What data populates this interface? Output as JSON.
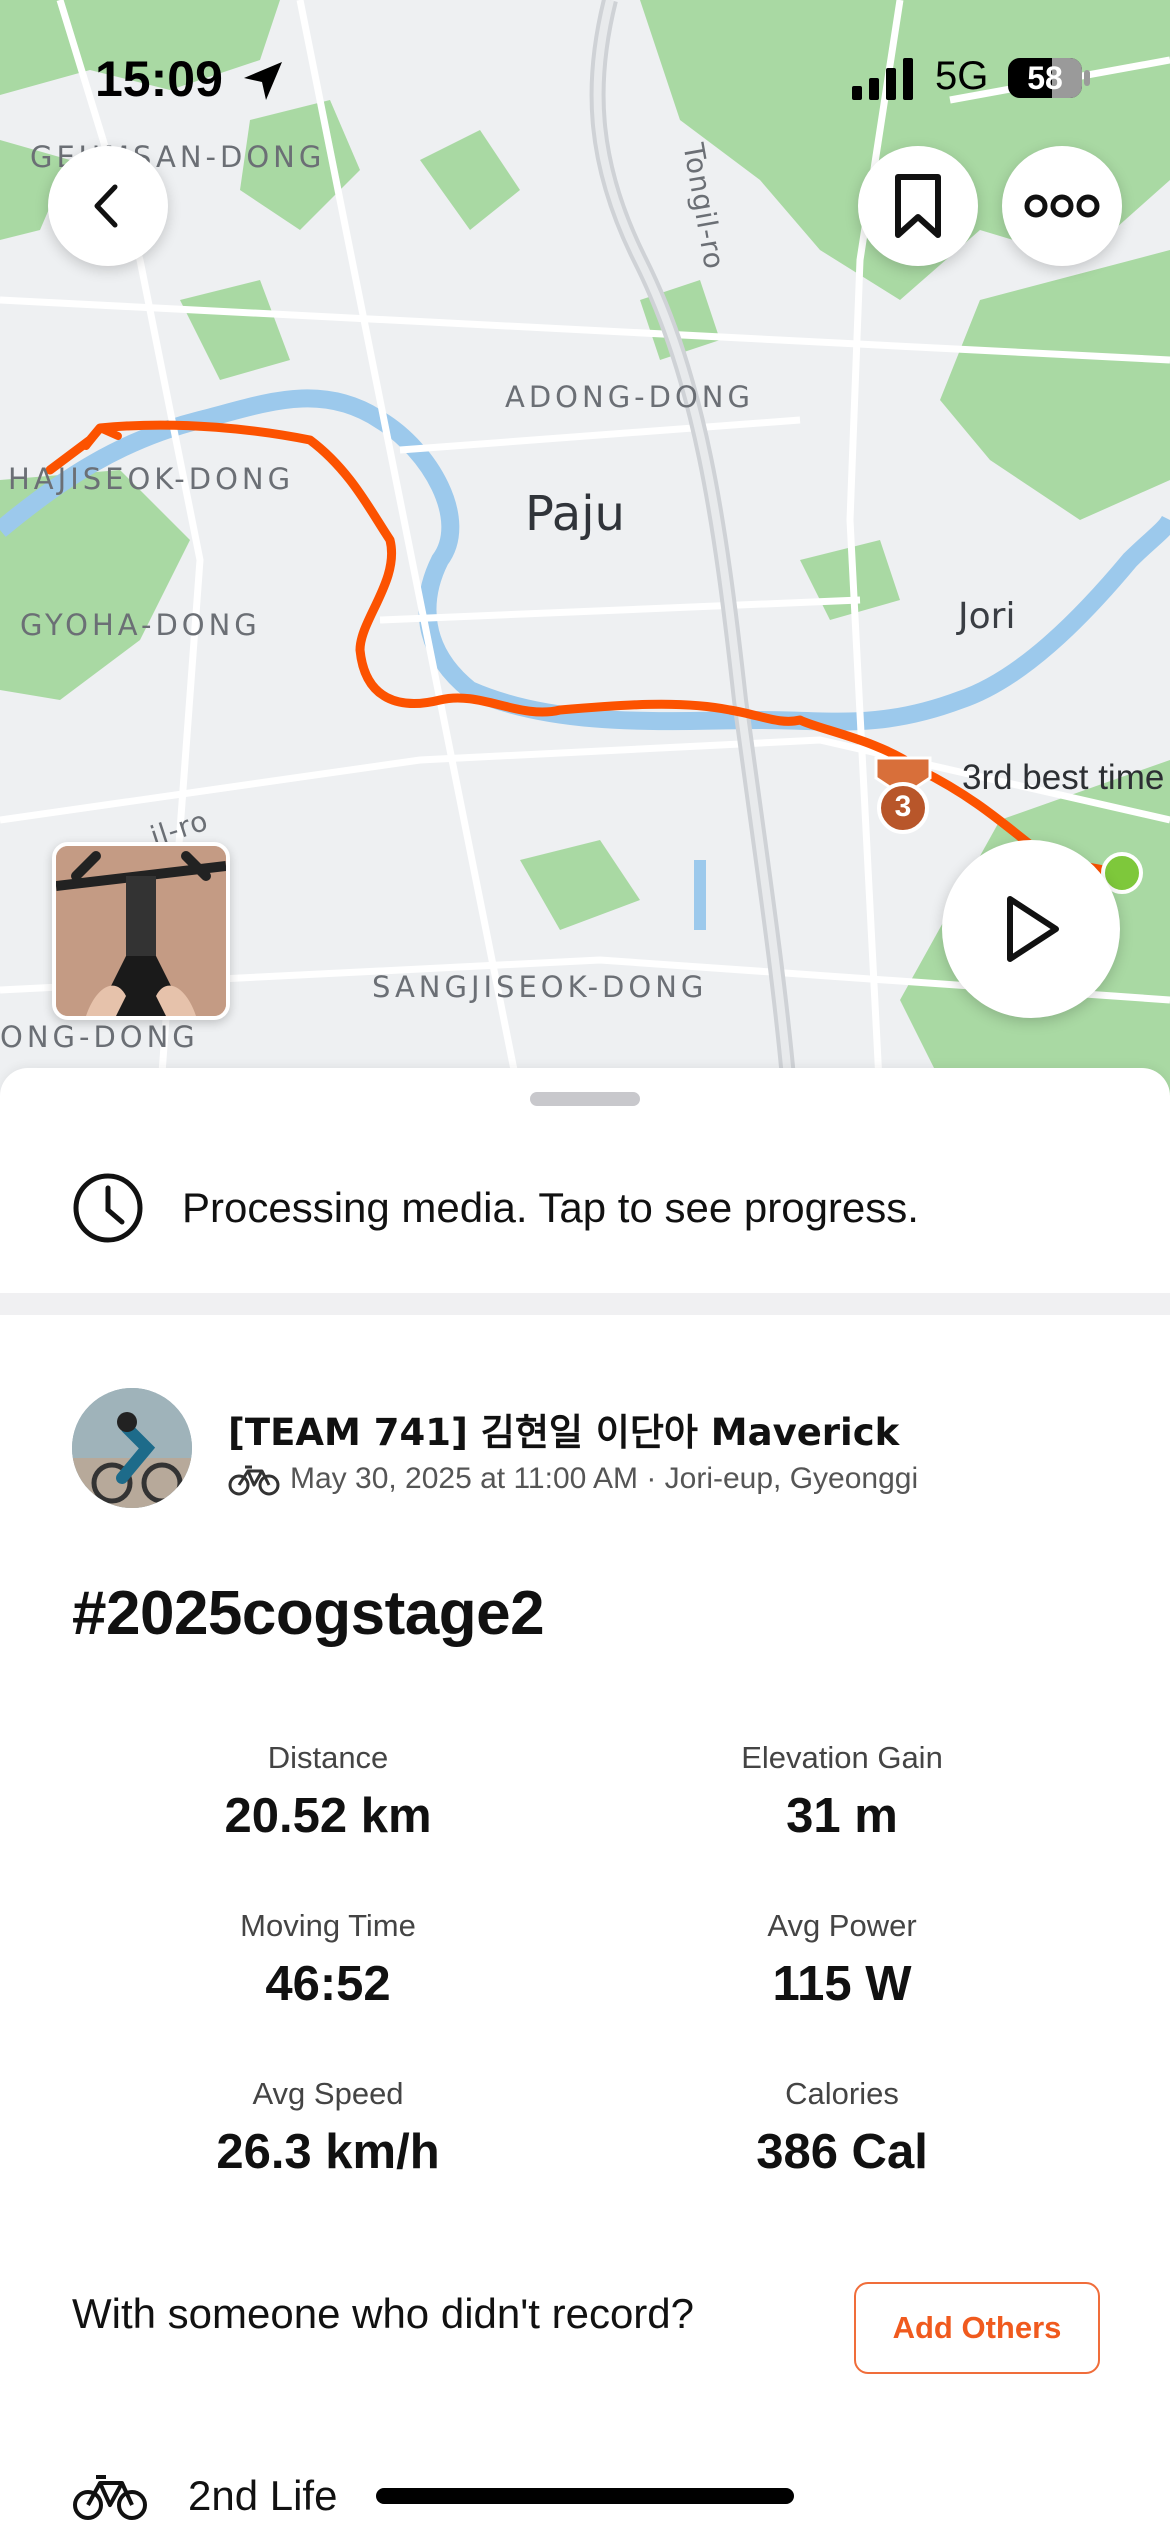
{
  "status_bar": {
    "time": "15:09",
    "network": "5G",
    "battery": "58"
  },
  "map": {
    "places": [
      "GEUMSAN-DONG",
      "ADONG-DONG",
      "Paju",
      "HAJISEOK-DONG",
      "GYOHA-DONG",
      "Jori",
      "SANGJISEOK-DONG",
      "ONG-DONG",
      "Tongil-ro",
      "il-ro"
    ],
    "segment_badge": "3",
    "segment_label": "3rd best time",
    "route_color": "#fc5200"
  },
  "header_icons": {
    "back": "chevron-left-icon",
    "bookmark": "bookmark-icon",
    "more": "more-horizontal-icon",
    "play": "play-icon"
  },
  "processing": {
    "text": "Processing media. Tap to see progress."
  },
  "activity": {
    "athlete": "[TEAM 741] 김현일 이단아 Maverick",
    "meta": "May 30, 2025 at 11:00 AM · Jori-eup, Gyeonggi",
    "title": "#2025cogstage2",
    "stats": [
      {
        "label": "Distance",
        "value": "20.52 km"
      },
      {
        "label": "Elevation Gain",
        "value": "31 m"
      },
      {
        "label": "Moving Time",
        "value": "46:52"
      },
      {
        "label": "Avg Power",
        "value": "115 W"
      },
      {
        "label": "Avg Speed",
        "value": "26.3 km/h"
      },
      {
        "label": "Calories",
        "value": "386 Cal"
      }
    ]
  },
  "together": {
    "prompt": "With someone who didn't record?",
    "button": "Add Others"
  },
  "gear": {
    "name": "2nd Life"
  },
  "colors": {
    "accent": "#fc5200",
    "text": "#111111"
  }
}
